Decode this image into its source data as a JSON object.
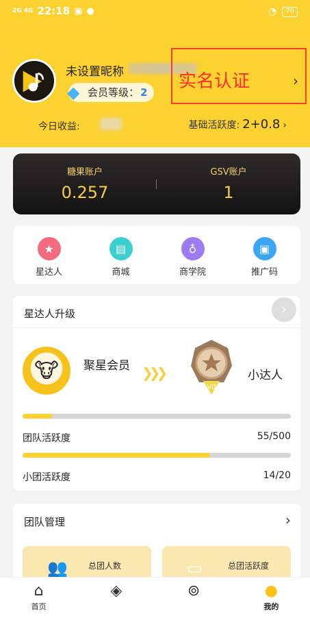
{
  "status_bar": {
    "network": "2G 4G",
    "time": "22:18",
    "battery": "70"
  },
  "profile": {
    "nickname": "未设置昵称",
    "member_level_label": "会员等级：",
    "member_level_value": "2",
    "realname_text": "实名认证",
    "today_earnings_label": "今日收益:",
    "base_activity_label": "基础活跃度:",
    "base_activity_value": "2+0.8"
  },
  "accounts": [
    {
      "label": "糖果账户",
      "value": "0.257"
    },
    {
      "label": "GSV账户",
      "value": "1"
    }
  ],
  "actions": [
    {
      "label": "星达人",
      "icon": "star-icon",
      "color": "#f56b7e"
    },
    {
      "label": "商城",
      "icon": "shop-icon",
      "color": "#3ccfcf"
    },
    {
      "label": "商学院",
      "icon": "gourd-icon",
      "color": "#9b7cf1"
    },
    {
      "label": "推广码",
      "icon": "badge-icon",
      "color": "#3aa6f5"
    }
  ],
  "upgrade": {
    "title": "星达人升级",
    "current_level": "聚星会员",
    "next_level": "小达人",
    "progress_fraction": 0.11,
    "team_activity_label": "团队活跃度",
    "team_activity_value": "55/500",
    "team_activity_fraction": 0.7,
    "small_team_activity_label": "小团活跃度",
    "small_team_activity_value": "14/20"
  },
  "team": {
    "title": "团队管理",
    "stat_cards": [
      {
        "label": "总团人数",
        "icon": "people-icon"
      },
      {
        "label": "总团活跃度",
        "icon": "pulse-icon"
      }
    ]
  },
  "bottom_nav": [
    {
      "label": "首页",
      "icon": "home-icon",
      "active": false
    },
    {
      "label": "我的",
      "icon": "profile-icon",
      "active": true
    }
  ]
}
